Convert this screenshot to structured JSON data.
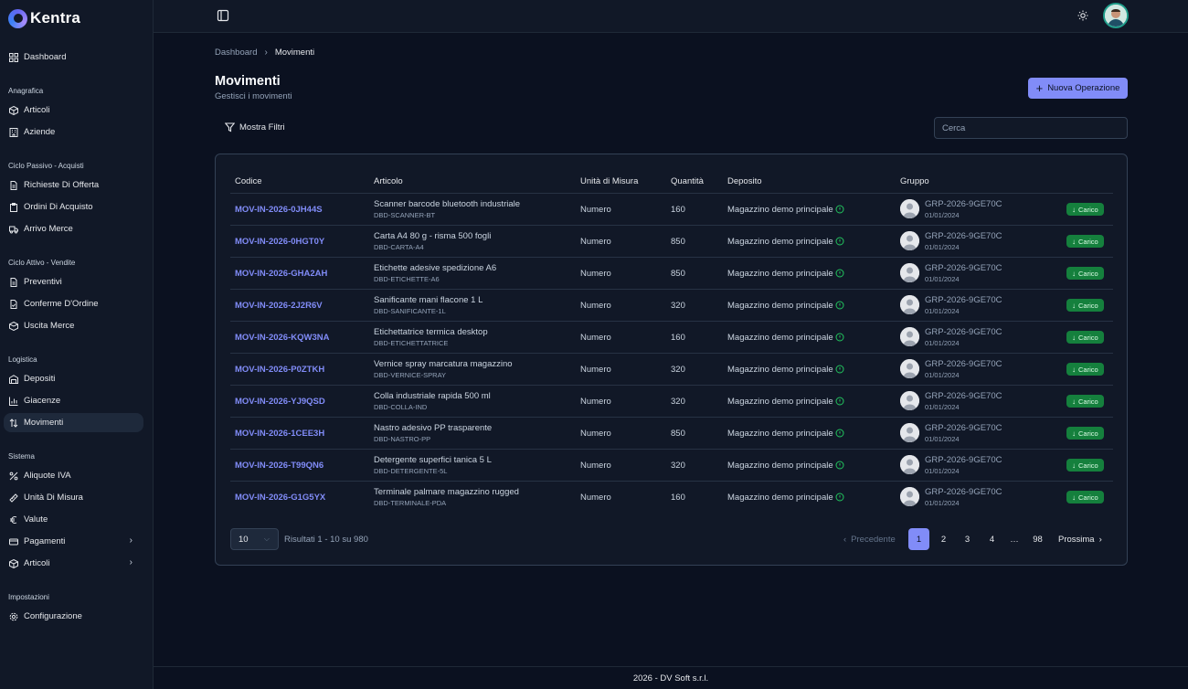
{
  "app": {
    "name": "Kentra"
  },
  "sidebar": {
    "dashboard": "Dashboard",
    "sections": {
      "anagrafica": {
        "title": "Anagrafica",
        "items": [
          "Articoli",
          "Aziende"
        ]
      },
      "acquisti": {
        "title": "Ciclo Passivo - Acquisti",
        "items": [
          "Richieste Di Offerta",
          "Ordini Di Acquisto",
          "Arrivo Merce"
        ]
      },
      "vendite": {
        "title": "Ciclo Attivo - Vendite",
        "items": [
          "Preventivi",
          "Conferme D'Ordine",
          "Uscita Merce"
        ]
      },
      "logistica": {
        "title": "Logistica",
        "items": [
          "Depositi",
          "Giacenze",
          "Movimenti"
        ]
      },
      "sistema": {
        "title": "Sistema",
        "items": [
          "Aliquote IVA",
          "Unità Di Misura",
          "Valute",
          "Pagamenti",
          "Articoli"
        ]
      },
      "impostazioni": {
        "title": "Impostazioni",
        "items": [
          "Configurazione"
        ]
      }
    },
    "active_item": "Movimenti"
  },
  "breadcrumb": {
    "root": "Dashboard",
    "current": "Movimenti"
  },
  "page": {
    "title": "Movimenti",
    "subtitle": "Gestisci i movimenti",
    "new_button": "Nuova Operazione",
    "filters_button": "Mostra Filtri",
    "search_placeholder": "Cerca"
  },
  "table": {
    "headers": [
      "Codice",
      "Articolo",
      "Unità di Misura",
      "Quantità",
      "Deposito",
      "Gruppo"
    ],
    "rows": [
      {
        "code": "MOV-IN-2026-0JH44S",
        "article": "Scanner barcode bluetooth industriale",
        "sku": "DBD-SCANNER-BT",
        "unit": "Numero",
        "qty": "160",
        "deposit": "Magazzino demo principale",
        "group": "GRP-2026-9GE70C",
        "date": "01/01/2024",
        "badge": "Carico"
      },
      {
        "code": "MOV-IN-2026-0HGT0Y",
        "article": "Carta A4 80 g - risma 500 fogli",
        "sku": "DBD-CARTA-A4",
        "unit": "Numero",
        "qty": "850",
        "deposit": "Magazzino demo principale",
        "group": "GRP-2026-9GE70C",
        "date": "01/01/2024",
        "badge": "Carico"
      },
      {
        "code": "MOV-IN-2026-GHA2AH",
        "article": "Etichette adesive spedizione A6",
        "sku": "DBD-ETICHETTE-A6",
        "unit": "Numero",
        "qty": "850",
        "deposit": "Magazzino demo principale",
        "group": "GRP-2026-9GE70C",
        "date": "01/01/2024",
        "badge": "Carico"
      },
      {
        "code": "MOV-IN-2026-2J2R6V",
        "article": "Sanificante mani flacone 1 L",
        "sku": "DBD-SANIFICANTE-1L",
        "unit": "Numero",
        "qty": "320",
        "deposit": "Magazzino demo principale",
        "group": "GRP-2026-9GE70C",
        "date": "01/01/2024",
        "badge": "Carico"
      },
      {
        "code": "MOV-IN-2026-KQW3NA",
        "article": "Etichettatrice termica desktop",
        "sku": "DBD-ETICHETTATRICE",
        "unit": "Numero",
        "qty": "160",
        "deposit": "Magazzino demo principale",
        "group": "GRP-2026-9GE70C",
        "date": "01/01/2024",
        "badge": "Carico"
      },
      {
        "code": "MOV-IN-2026-P0ZTKH",
        "article": "Vernice spray marcatura magazzino",
        "sku": "DBD-VERNICE-SPRAY",
        "unit": "Numero",
        "qty": "320",
        "deposit": "Magazzino demo principale",
        "group": "GRP-2026-9GE70C",
        "date": "01/01/2024",
        "badge": "Carico"
      },
      {
        "code": "MOV-IN-2026-YJ9QSD",
        "article": "Colla industriale rapida 500 ml",
        "sku": "DBD-COLLA-IND",
        "unit": "Numero",
        "qty": "320",
        "deposit": "Magazzino demo principale",
        "group": "GRP-2026-9GE70C",
        "date": "01/01/2024",
        "badge": "Carico"
      },
      {
        "code": "MOV-IN-2026-1CEE3H",
        "article": "Nastro adesivo PP trasparente",
        "sku": "DBD-NASTRO-PP",
        "unit": "Numero",
        "qty": "850",
        "deposit": "Magazzino demo principale",
        "group": "GRP-2026-9GE70C",
        "date": "01/01/2024",
        "badge": "Carico"
      },
      {
        "code": "MOV-IN-2026-T99QN6",
        "article": "Detergente superfici tanica 5 L",
        "sku": "DBD-DETERGENTE-5L",
        "unit": "Numero",
        "qty": "320",
        "deposit": "Magazzino demo principale",
        "group": "GRP-2026-9GE70C",
        "date": "01/01/2024",
        "badge": "Carico"
      },
      {
        "code": "MOV-IN-2026-G1G5YX",
        "article": "Terminale palmare magazzino rugged",
        "sku": "DBD-TERMINALE-PDA",
        "unit": "Numero",
        "qty": "160",
        "deposit": "Magazzino demo principale",
        "group": "GRP-2026-9GE70C",
        "date": "01/01/2024",
        "badge": "Carico"
      }
    ]
  },
  "pagination": {
    "page_size": "10",
    "results_text": "Risultati 1 - 10 su 980",
    "prev": "Precedente",
    "next": "Prossima",
    "pages": [
      "1",
      "2",
      "3",
      "4",
      "…",
      "98"
    ],
    "current": "1"
  },
  "footer": {
    "text": "2026 - DV Soft s.r.l."
  },
  "colors": {
    "accent": "#818cf8",
    "badge": "#15803d",
    "background": "#0b1120",
    "sidebar": "#111827"
  }
}
